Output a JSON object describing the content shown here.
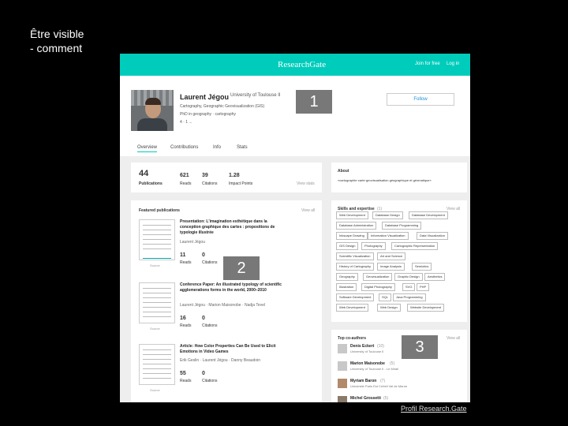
{
  "slide": {
    "title": "Être visible",
    "subtitle": "- comment"
  },
  "caption": "Profil Research.Gate",
  "site": {
    "brand": "ResearchGate",
    "join": "Join for free",
    "login": "Log in"
  },
  "profile": {
    "name": "Laurent Jégou",
    "institution": "University of Toulouse II",
    "line1": "Cartography, Geographic Geovisualization (GIS)",
    "line2": "PhD in geography · cartography",
    "line3": "4 · 1 ...",
    "follow": "Follow"
  },
  "tabs": [
    "Overview",
    "Contributions",
    "Info",
    "Stats"
  ],
  "stats": {
    "publications": "44",
    "publications_label": "Publications",
    "reads": "621",
    "reads_label": "Reads",
    "citations": "39",
    "citations_label": "Citations",
    "impact": "1.28",
    "impact_label": "Impact Points",
    "view_stats": "View stats"
  },
  "about": {
    "title": "About",
    "text": "«cartographie·carte·geovisualisation géographique et géomatique»"
  },
  "featured": {
    "title": "Featured publications",
    "view_all": "View all",
    "items": [
      {
        "title": "Presentation: L'imagination esthétique dans la conception graphique des cartes : propositions de typologie illustrée",
        "authors": "Laurent Jégou",
        "reads": "11",
        "reads_label": "Reads",
        "cit": "0",
        "cit_label": "Citations",
        "source": "Source"
      },
      {
        "title": "Conference Paper: An illustrated typology of scientific agglomerations forms in the world, 2000–2010",
        "authors": "Laurent Jégou · Marion Maisonobe · Nadja Tevel",
        "reads": "16",
        "reads_label": "Reads",
        "cit": "0",
        "cit_label": "Citations",
        "source": "Source"
      },
      {
        "title": "Article: How Color Properties Can Be Used to Elicit Emotions in Video Games",
        "authors": "Erik Geslin · Laurent Jégou · Danny Beaudoin",
        "reads": "55",
        "reads_label": "Reads",
        "cit": "0",
        "cit_label": "Citations",
        "source": "Source"
      }
    ]
  },
  "skills": {
    "title": "Skills and expertise",
    "count": "(1)",
    "view_all": "View all",
    "chips": [
      "Web Development",
      "Database Design",
      "Database Development",
      "Database Administration",
      "Database Programming",
      "Inkscape Drawing",
      "Information Visualization",
      "Data Visualization",
      "GIS Design",
      "Photography",
      "Cartographic Representation",
      "Scientific Visualization",
      "Art and Science",
      "History of Cartography",
      "Image Analysis",
      "Semiotics",
      "Geography",
      "Geovisualization",
      "Graphic Design",
      "Aesthetics",
      "Illustration",
      "Digital Photography",
      "SVG",
      "PHP",
      "Software Development",
      "SQL",
      "Java Programming",
      "Web Development",
      "Web Design",
      "Website Development"
    ]
  },
  "coauthors": {
    "title": "Top co-authors",
    "view_all": "View all",
    "items": [
      {
        "name": "Denis Eckert",
        "count": "(10)",
        "inst": "University of Toulouse II"
      },
      {
        "name": "Marion Maisonobe",
        "count": "(5)",
        "inst": "University of Toulouse II - Le Mirail"
      },
      {
        "name": "Myriam Baron",
        "count": "(7)",
        "inst": "Université Paris Est Créteil Val de Marne"
      },
      {
        "name": "Michel Grossetti",
        "count": "(5)",
        "inst": ""
      }
    ]
  },
  "callouts": [
    "1",
    "2",
    "3"
  ]
}
